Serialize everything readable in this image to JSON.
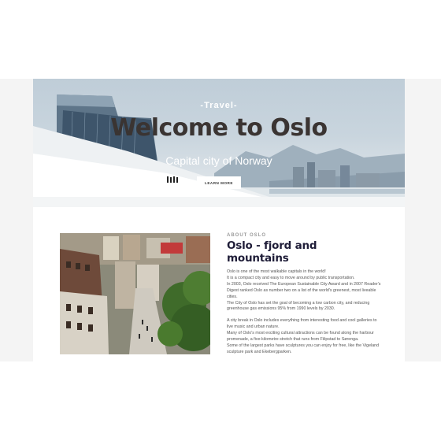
{
  "hero": {
    "kicker": "-Travel-",
    "title": "Welcome to Oslo",
    "subtitle": "Capital city of Norway",
    "button_label": "LEARN MORE"
  },
  "about": {
    "label": "ABOUT OSLO",
    "title": "Oslo - fjord and mountains",
    "paragraph1": [
      "Oslo is one of the most walkable capitals in the world!",
      "It is a compact city and easy to move around by public transportation.",
      "In 2003, Oslo received The European Sustainable City Award and in 2007 Reader's Digest ranked Oslo as number two on a list of the world's greenest, most liveable cities.",
      "The City of Oslo has set the goal of becoming a low carbon city, and reducing greenhouse gas emissions 95% from 1990 levels by 2030."
    ],
    "paragraph2": [
      "A city break in Oslo includes everything from interesting food and cool galleries to live music and urban nature.",
      "Many of Oslo's most exciting cultural attractions can be found along the harbour promenade, a five-kilometre stretch that runs from Filipstad to Sørenga.",
      "Some of the largest parks have sculptures you can enjoy for free, like the Vigeland sculpture park and Ekebergparken."
    ]
  },
  "colors": {
    "title_dark": "#3a3432",
    "heading_navy": "#1f1d38",
    "body_text": "#555555",
    "band_gray": "#f4f4f4"
  }
}
